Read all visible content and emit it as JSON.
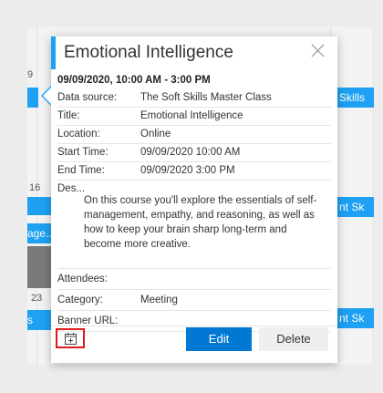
{
  "background": {
    "event_right_top": "Skills",
    "event_right_mid": "nt Sk",
    "event_right_bottom": "nt Sk",
    "event_left_mid": "age...",
    "event_left_bottom": "s",
    "day_num_1": "16",
    "day_num_2": "23",
    "day_num_3": "9"
  },
  "popup": {
    "title": "Emotional Intelligence",
    "datetime": "09/09/2020, 10:00 AM - 3:00 PM",
    "fields": {
      "data_source_label": "Data source:",
      "data_source_value": "The Soft Skills Master Class",
      "title_label": "Title:",
      "title_value": "Emotional Intelligence",
      "location_label": "Location:",
      "location_value": "Online",
      "start_label": "Start Time:",
      "start_value": "09/09/2020 10:00 AM",
      "end_label": "End Time:",
      "end_value": "09/09/2020 3:00 PM",
      "description_label": "Des...",
      "description_value": "On this course you'll explore the essentials of self-management, empathy, and reasoning, as well as how to keep your brain sharp long-term and become more creative.",
      "attendees_label": "Attendees:",
      "attendees_value": "",
      "category_label": "Category:",
      "category_value": "Meeting",
      "banner_label": "Banner URL:",
      "banner_value": ""
    },
    "edit_label": "Edit",
    "delete_label": "Delete",
    "calendar_icon": "calendar-add-icon",
    "accent_color": "#1ea1f2",
    "primary_color": "#0078d4",
    "highlight_color": "#e01b1b"
  }
}
